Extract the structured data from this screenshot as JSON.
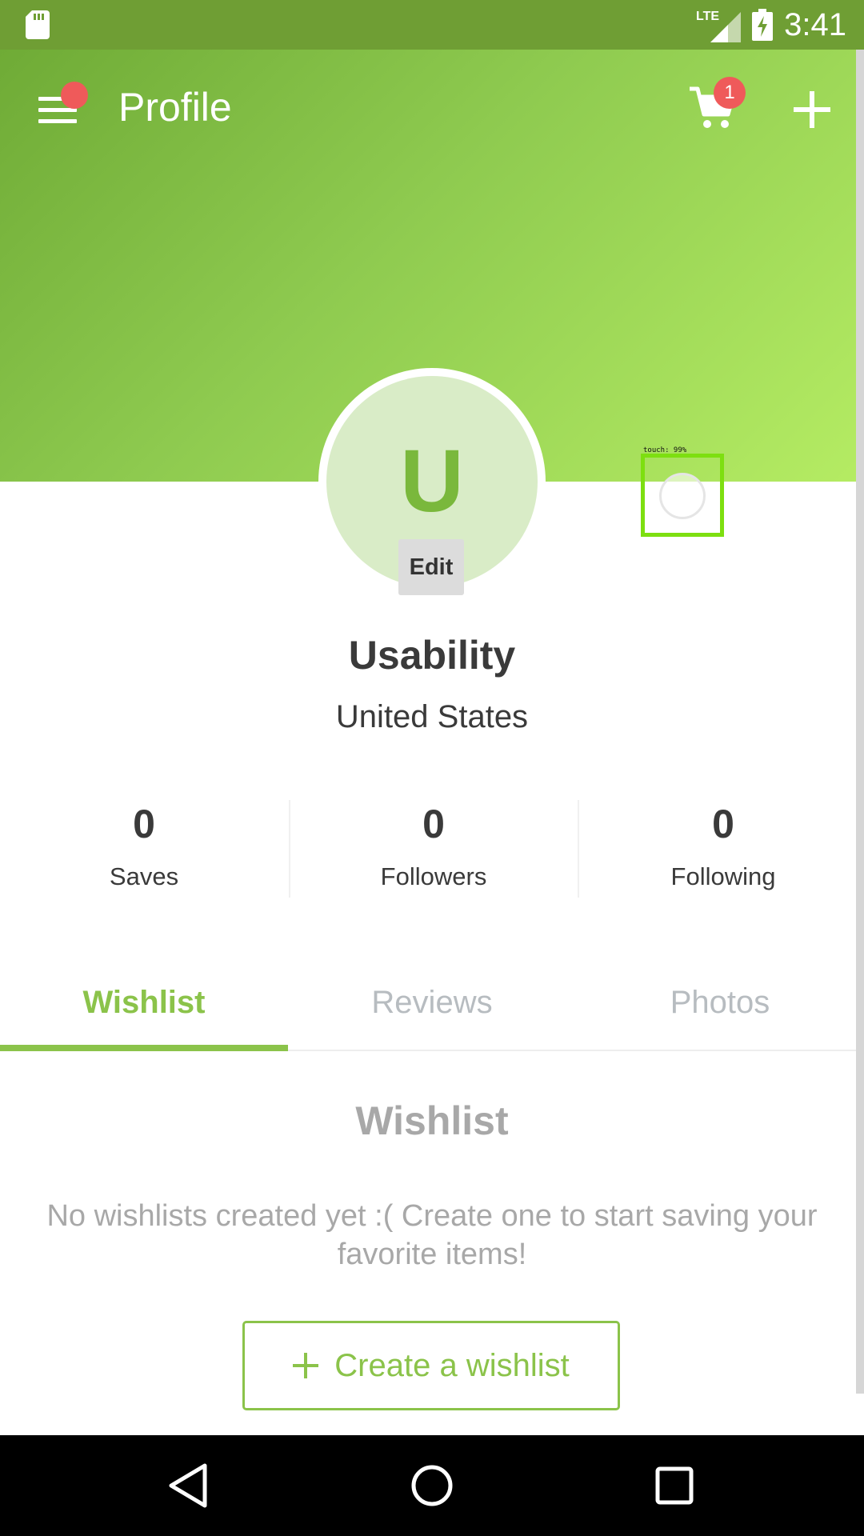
{
  "status_bar": {
    "network": "LTE",
    "time": "3:41",
    "icons": [
      "sd-card-icon",
      "signal-icon",
      "battery-charging-icon"
    ]
  },
  "header": {
    "title": "Profile",
    "cart_count": "1",
    "icons": [
      "menu-icon",
      "cart-icon",
      "add-icon"
    ]
  },
  "profile": {
    "avatar_letter": "U",
    "edit_label": "Edit",
    "name": "Usability",
    "location": "United States"
  },
  "touch_overlay": {
    "label": "touch: 99%"
  },
  "stats": [
    {
      "value": "0",
      "label": "Saves"
    },
    {
      "value": "0",
      "label": "Followers"
    },
    {
      "value": "0",
      "label": "Following"
    }
  ],
  "tabs": [
    {
      "label": "Wishlist",
      "active": true
    },
    {
      "label": "Reviews",
      "active": false
    },
    {
      "label": "Photos",
      "active": false
    }
  ],
  "empty_state": {
    "title": "Wishlist",
    "message": "No wishlists created yet :( Create one to start saving your favorite items!",
    "button_label": "Create a wishlist"
  },
  "colors": {
    "accent": "#8bc34a",
    "status_bar": "#6f9e34",
    "badge": "#ef5a5a"
  },
  "nav_bar": {
    "icons": [
      "back-icon",
      "home-icon",
      "recents-icon"
    ]
  }
}
